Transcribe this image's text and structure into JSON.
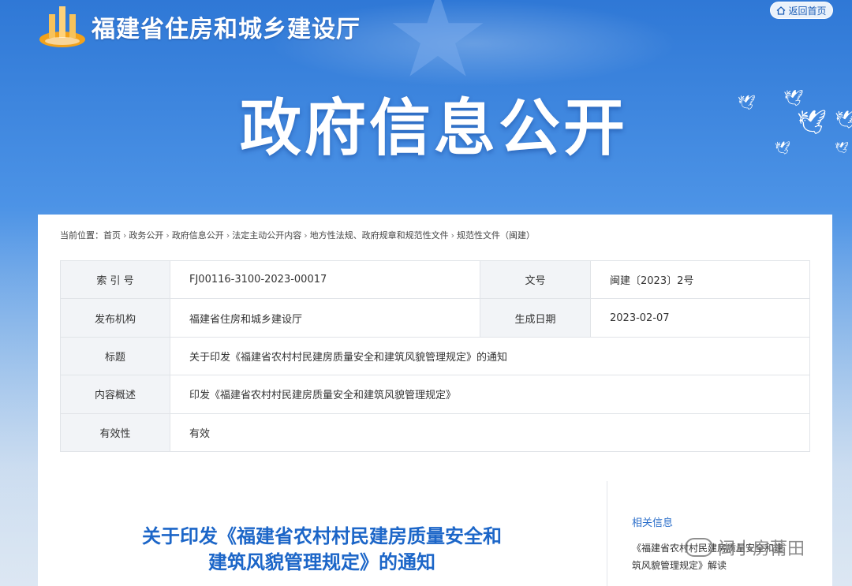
{
  "header": {
    "site_title": "福建省住房和城乡建设厅",
    "back_label": "返回首页",
    "back_icon": "home-icon"
  },
  "hero": {
    "title": "政府信息公开"
  },
  "breadcrumb": {
    "prefix": "当前位置：",
    "items": [
      "首页",
      "政务公开",
      "政府信息公开",
      "法定主动公开内容",
      "地方性法规、政府规章和规范性文件",
      "规范性文件（闽建）"
    ]
  },
  "info": {
    "index_label": "索 引 号",
    "index_value": "FJ00116-3100-2023-00017",
    "docno_label": "文号",
    "docno_value": "闽建〔2023〕2号",
    "issuer_label": "发布机构",
    "issuer_value": "福建省住房和城乡建设厅",
    "date_label": "生成日期",
    "date_value": "2023-02-07",
    "title_label": "标题",
    "title_value": "关于印发《福建省农村村民建房质量安全和建筑风貌管理规定》的通知",
    "summary_label": "内容概述",
    "summary_value": "印发《福建省农村村民建房质量安全和建筑风貌管理规定》",
    "validity_label": "有效性",
    "validity_value": "有效"
  },
  "document": {
    "title_line1": "关于印发《福建省农村村民建房质量安全和",
    "title_line2": "建筑风貌管理规定》的通知"
  },
  "related": {
    "heading": "相关信息",
    "item_line1": "《福建省农村村民建房质量安全和建",
    "item_line2": "筑风貌管理规定》解读"
  },
  "watermark": {
    "text": "闽小房莆田"
  },
  "colors": {
    "brand_blue": "#1c66c8",
    "label_bg": "#f2f4f7",
    "border": "#e1e4e8"
  }
}
